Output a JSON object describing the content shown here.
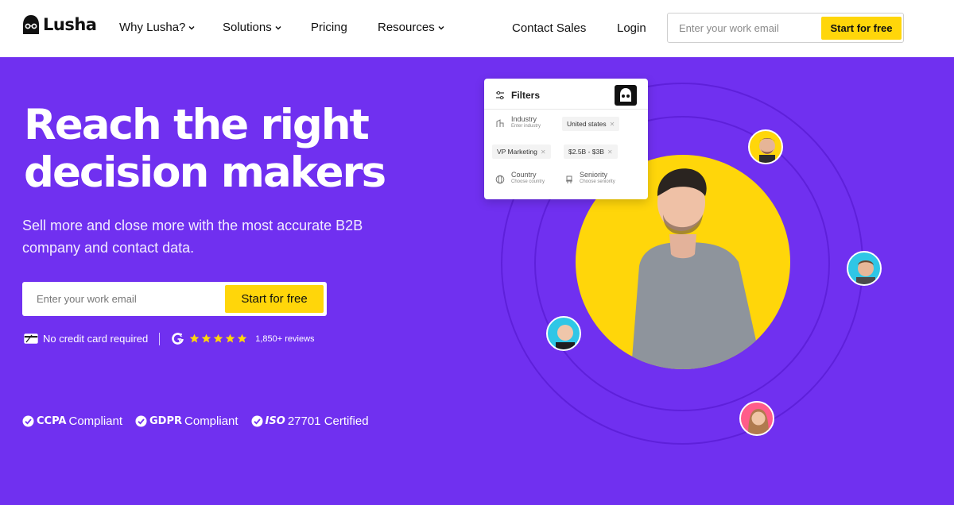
{
  "brand": {
    "name": "Lusha"
  },
  "nav": {
    "items": [
      {
        "label": "Why Lusha?",
        "dropdown": true
      },
      {
        "label": "Solutions",
        "dropdown": true
      },
      {
        "label": "Pricing",
        "dropdown": false
      },
      {
        "label": "Resources",
        "dropdown": true
      }
    ],
    "contact_label": "Contact Sales",
    "login_label": "Login",
    "email_placeholder": "Enter your work email",
    "cta_label": "Start for free"
  },
  "hero": {
    "headline": "Reach the right decision makers",
    "subheadline": "Sell more and close more with the most accurate B2B company and contact data.",
    "email_placeholder": "Enter your work email",
    "cta_label": "Start for free",
    "no_card_text": "No credit card required",
    "rating_stars": 5,
    "reviews_text": "1,850+ reviews"
  },
  "compliance": [
    {
      "bold": "CCPA",
      "rest": " Compliant"
    },
    {
      "bold": "GDPR",
      "rest": " Compliant"
    },
    {
      "bold": "ISO",
      "rest": " 27701 Certified"
    }
  ],
  "filters_card": {
    "title": "Filters",
    "industry": {
      "label": "Industry",
      "hint": "Enter industry"
    },
    "chips": [
      "United states",
      "VP Marketing",
      "$2.5B - $3B"
    ],
    "country": {
      "label": "Country",
      "hint": "Choose country"
    },
    "seniority": {
      "label": "Seniority",
      "hint": "Choose seniority"
    }
  },
  "colors": {
    "hero_bg": "#7030f0",
    "accent_yellow": "#ffd60a",
    "header_bg": "#ffffff"
  },
  "icons": [
    "lusha-logo-icon",
    "chevron-down-icon",
    "credit-card-icon",
    "g2-icon",
    "star-icon",
    "check-circle-icon",
    "sliders-icon"
  ]
}
